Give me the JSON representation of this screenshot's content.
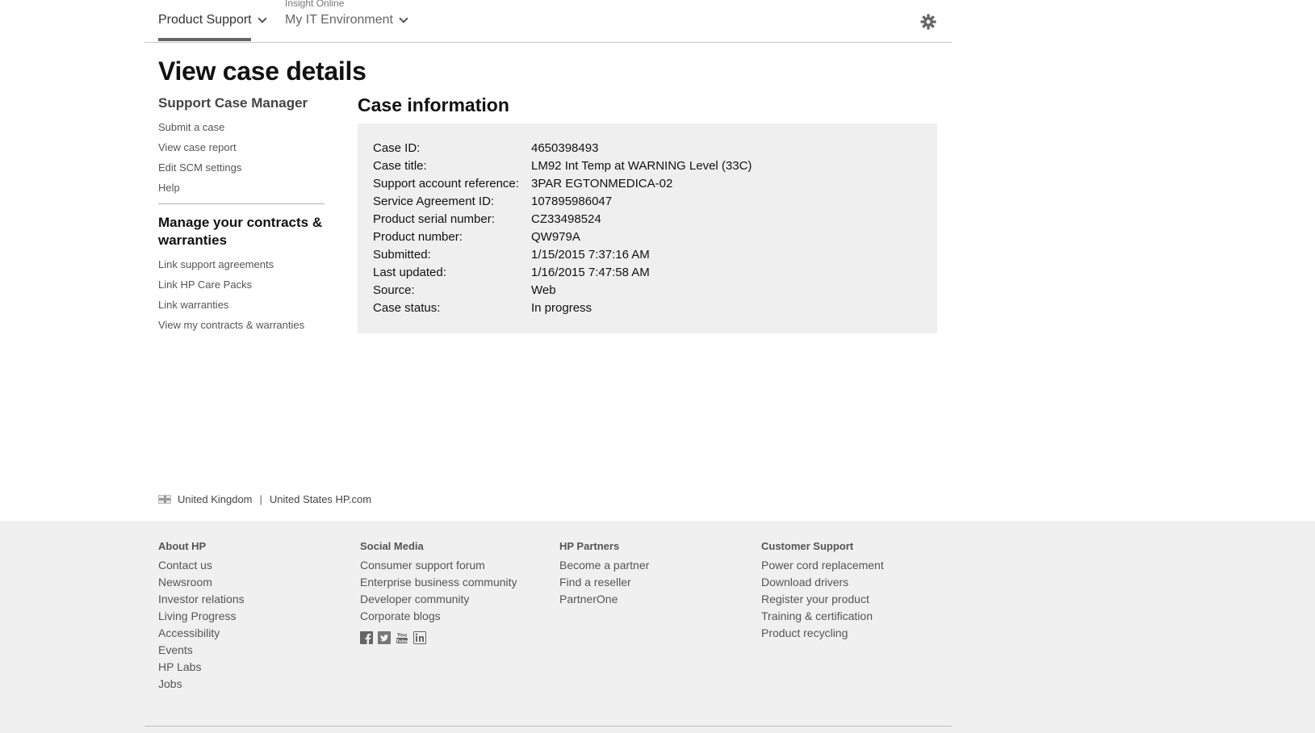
{
  "nav": {
    "superlabel": "Insight Online",
    "tabs": [
      {
        "label": "Product Support",
        "active": true
      },
      {
        "label": "My IT Environment",
        "active": false
      }
    ],
    "settings_icon": "gear-icon"
  },
  "page": {
    "title": "View case details"
  },
  "sidebar": {
    "section1": {
      "heading": "Support Case Manager",
      "links": [
        "Submit a case",
        "View case report",
        "Edit SCM settings",
        "Help"
      ]
    },
    "section2": {
      "heading": "Manage your contracts & warranties",
      "links": [
        "Link support agreements",
        "Link HP Care Packs",
        "Link warranties",
        "View my contracts & warranties"
      ]
    }
  },
  "case": {
    "heading": "Case information",
    "rows": [
      {
        "label": "Case ID:",
        "value": "4650398493"
      },
      {
        "label": "Case title:",
        "value": "LM92 Int Temp at WARNING Level (33C)"
      },
      {
        "label": "Support account reference:",
        "value": "3PAR EGTONMEDICA-02"
      },
      {
        "label": "Service Agreement ID:",
        "value": "107895986047"
      },
      {
        "label": "Product serial number:",
        "value": "CZ33498524"
      },
      {
        "label": "Product number:",
        "value": "QW979A"
      },
      {
        "label": "Submitted:",
        "value": "1/15/2015 7:37:16 AM"
      },
      {
        "label": "Last updated:",
        "value": "1/16/2015 7:47:58 AM"
      },
      {
        "label": "Source:",
        "value": "Web"
      },
      {
        "label": "Case status:",
        "value": "In progress"
      }
    ]
  },
  "locale": {
    "country": "United Kingdom",
    "separator": "|",
    "alt_link": "United States HP.com"
  },
  "footer": {
    "columns": [
      {
        "heading": "About HP",
        "links": [
          "Contact us",
          "Newsroom",
          "Investor relations",
          "Living Progress",
          "Accessibility",
          "Events",
          "HP Labs",
          "Jobs"
        ]
      },
      {
        "heading": "Social Media",
        "links": [
          "Consumer support forum",
          "Enterprise business community",
          "Developer community",
          "Corporate blogs"
        ]
      },
      {
        "heading": "HP Partners",
        "links": [
          "Become a partner",
          "Find a reseller",
          "PartnerOne"
        ]
      },
      {
        "heading": "Customer Support",
        "links": [
          "Power cord replacement",
          "Download drivers",
          "Register your product",
          "Training & certification",
          "Product recycling"
        ]
      }
    ],
    "social_icons": [
      "facebook-icon",
      "twitter-icon",
      "youtube-icon",
      "linkedin-icon"
    ]
  },
  "colors": {
    "case_box_bg": "#efefef",
    "footer_bg": "#f0f0f0",
    "active_tab_underline": "#666666"
  }
}
